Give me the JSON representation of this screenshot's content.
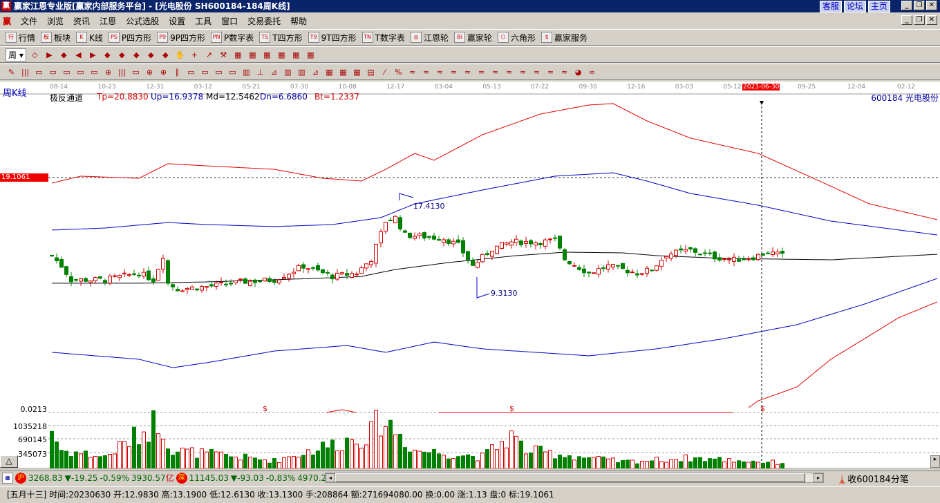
{
  "window": {
    "title": "赢家江恩专业版[赢家内部服务平台] - [光电股份   SH600184-184周K线]",
    "links": [
      "客服",
      "论坛",
      "主页"
    ],
    "app_icon": "赢"
  },
  "menu": {
    "logo": "赢",
    "items": [
      "文件",
      "浏览",
      "资讯",
      "江恩",
      "公式选股",
      "设置",
      "工具",
      "窗口",
      "交易委托",
      "帮助"
    ]
  },
  "toolbar1": [
    {
      "icon": "行",
      "label": "行情"
    },
    {
      "icon": "板",
      "label": "板块"
    },
    {
      "icon": "K",
      "label": "K线"
    },
    {
      "icon": "PS",
      "label": "P四方形"
    },
    {
      "icon": "P9",
      "label": "9P四方形"
    },
    {
      "icon": "PN",
      "label": "P数字表"
    },
    {
      "icon": "TS",
      "label": "T四方形"
    },
    {
      "icon": "T9",
      "label": "9T四方形"
    },
    {
      "icon": "TN",
      "label": "T数字表"
    },
    {
      "icon": "◎",
      "label": "江恩轮"
    },
    {
      "icon": "Bi",
      "label": "赢家轮"
    },
    {
      "icon": "⬡",
      "label": "六角形"
    },
    {
      "icon": "$",
      "label": "赢家服务"
    }
  ],
  "toolbar2": {
    "period_button": "周",
    "icons": [
      "◇",
      "▶",
      "◆",
      "◀",
      "▶",
      "◆",
      "◆",
      "◆",
      "◆",
      "◆",
      "✋",
      "+",
      "↗",
      "⚒",
      "▦",
      "▦",
      "▦",
      "▦",
      "▦",
      "▦"
    ]
  },
  "toolbar3": {
    "icons": [
      "✎",
      "|||",
      "▭",
      "▭",
      "▭",
      "▭",
      "▭",
      "⊕",
      "|||",
      "▭",
      "⊕",
      "⊕",
      "∥",
      "▭",
      "▭",
      "▭",
      "▭",
      "▥",
      "⊥",
      "⊿",
      "▥",
      "▥",
      "⊿",
      "▦",
      "▦",
      "▦",
      "▤",
      "⁄",
      "%",
      "≈",
      "≈",
      "≈",
      "≈",
      "≈",
      "≈",
      "≈",
      "≈",
      "≈",
      "≈",
      "≈",
      "≈",
      "◕",
      "∞"
    ]
  },
  "chart": {
    "period_label": "周K线",
    "stock_label": "600184  光电股份",
    "indicator_name": "极反通道",
    "indicators": [
      {
        "text": "Tp=20.8830",
        "color": "#d00000"
      },
      {
        "text": "Up=16.9378",
        "color": "#0000a0"
      },
      {
        "text": "Md=12.5462",
        "color": "#000000"
      },
      {
        "text": "Dn=6.6860",
        "color": "#0000a0"
      },
      {
        "text": "Bt=1.2337",
        "color": "#d00000"
      }
    ],
    "dates": [
      "08-14",
      "10-23",
      "12-31",
      "03-12",
      "05-21",
      "07-30",
      "10-08",
      "12-17",
      "03-04",
      "05-13",
      "07-22",
      "09-30",
      "12-16",
      "03-03",
      "05-12",
      "2023-06-30",
      "09-25",
      "12-04",
      "02-12"
    ],
    "highlight_date": "2023-06-30",
    "cursor_price": "19.1061",
    "high_label": "17.4130",
    "low_label": "9.3130",
    "sub_axis": {
      "indicator_value": "0.0213",
      "volume_ticks": [
        "1035218",
        "690145",
        "345073"
      ],
      "marker": "$"
    },
    "colors": {
      "up": "#d00000",
      "down": "#008000",
      "upper_red": "#e00000",
      "band_blue": "#0000c0",
      "mid": "#000000"
    }
  },
  "chart_data": {
    "type": "candlestick",
    "price_keypoints_week_close": [
      [
        0,
        12.79
      ],
      [
        2,
        11.92
      ],
      [
        4,
        10.77
      ],
      [
        11,
        10.77
      ],
      [
        18,
        11.34
      ],
      [
        21,
        10.77
      ],
      [
        23,
        12.79
      ],
      [
        24,
        10.48
      ],
      [
        26,
        10.01
      ],
      [
        32,
        10.19
      ],
      [
        39,
        10.59
      ],
      [
        46,
        10.77
      ],
      [
        52,
        11.92
      ],
      [
        58,
        11.05
      ],
      [
        63,
        11.34
      ],
      [
        66,
        12.5
      ],
      [
        69,
        15.68
      ],
      [
        71,
        15.97
      ],
      [
        73,
        14.52
      ],
      [
        81,
        14.23
      ],
      [
        84,
        13.66
      ],
      [
        87,
        11.92
      ],
      [
        91,
        13.37
      ],
      [
        95,
        13.94
      ],
      [
        101,
        13.94
      ],
      [
        104,
        14.06
      ],
      [
        106,
        12.5
      ],
      [
        111,
        11.34
      ],
      [
        115,
        11.92
      ],
      [
        121,
        11.34
      ],
      [
        124,
        11.63
      ],
      [
        127,
        12.9
      ],
      [
        132,
        13.25
      ],
      [
        137,
        12.67
      ],
      [
        141,
        12.44
      ],
      [
        145,
        12.67
      ],
      [
        148,
        13.08
      ],
      [
        151,
        12.79
      ]
    ],
    "tp_line": [
      [
        0,
        18.86
      ],
      [
        6,
        19.44
      ],
      [
        18,
        19.26
      ],
      [
        24,
        20.48
      ],
      [
        32,
        20.3
      ],
      [
        46,
        20.01
      ],
      [
        56,
        19.26
      ],
      [
        64,
        19.03
      ],
      [
        69,
        20.01
      ],
      [
        75,
        21.34
      ],
      [
        79,
        20.77
      ],
      [
        89,
        22.9
      ],
      [
        101,
        24.64
      ],
      [
        111,
        25.39
      ],
      [
        116,
        25.51
      ],
      [
        123,
        24.06
      ],
      [
        132,
        22.62
      ],
      [
        146,
        21.34
      ],
      [
        158,
        19.15
      ],
      [
        169,
        17.12
      ],
      [
        183,
        15.8
      ]
    ],
    "up_line": [
      [
        0,
        14.93
      ],
      [
        11,
        15.1
      ],
      [
        24,
        15.56
      ],
      [
        32,
        15.39
      ],
      [
        46,
        15.22
      ],
      [
        58,
        15.39
      ],
      [
        68,
        15.97
      ],
      [
        75,
        17.12
      ],
      [
        89,
        18.28
      ],
      [
        104,
        19.44
      ],
      [
        116,
        19.72
      ],
      [
        123,
        19.03
      ],
      [
        132,
        17.99
      ],
      [
        146,
        17.01
      ],
      [
        161,
        15.68
      ],
      [
        183,
        14.52
      ]
    ],
    "md_line": [
      [
        0,
        10.48
      ],
      [
        18,
        10.48
      ],
      [
        32,
        10.59
      ],
      [
        54,
        10.88
      ],
      [
        64,
        11.05
      ],
      [
        71,
        11.63
      ],
      [
        82,
        12.21
      ],
      [
        96,
        12.79
      ],
      [
        106,
        13.08
      ],
      [
        118,
        13.02
      ],
      [
        125,
        12.79
      ],
      [
        139,
        12.56
      ],
      [
        161,
        12.44
      ],
      [
        183,
        12.9
      ]
    ],
    "dn_line": [
      [
        0,
        4.7
      ],
      [
        18,
        4.12
      ],
      [
        25,
        3.42
      ],
      [
        32,
        3.83
      ],
      [
        46,
        4.81
      ],
      [
        61,
        5.27
      ],
      [
        69,
        4.7
      ],
      [
        79,
        5.56
      ],
      [
        89,
        4.99
      ],
      [
        111,
        4.41
      ],
      [
        125,
        4.99
      ],
      [
        139,
        5.85
      ],
      [
        154,
        7.01
      ],
      [
        168,
        8.74
      ],
      [
        183,
        10.88
      ]
    ],
    "bt_line": [
      [
        144,
        0.07
      ],
      [
        146,
        0.65
      ],
      [
        154,
        1.8
      ],
      [
        161,
        4.12
      ],
      [
        168,
        5.85
      ],
      [
        175,
        7.59
      ],
      [
        183,
        8.92
      ]
    ],
    "volume_keypoints": [
      [
        0,
        1000000
      ],
      [
        2,
        470000
      ],
      [
        11,
        300000
      ],
      [
        20,
        1050000
      ],
      [
        22,
        1300000
      ],
      [
        25,
        470000
      ],
      [
        46,
        200000
      ],
      [
        66,
        900000
      ],
      [
        68,
        1300000
      ],
      [
        71,
        1000000
      ],
      [
        75,
        470000
      ],
      [
        89,
        300000
      ],
      [
        95,
        850000
      ],
      [
        98,
        470000
      ],
      [
        118,
        170000
      ],
      [
        132,
        270000
      ],
      [
        152,
        140000
      ]
    ],
    "y_price_labels": [
      "19.1061",
      "17.4130",
      "9.3130"
    ]
  },
  "status": {
    "sh_badge": "沪",
    "sh_index": "3268.83",
    "sh_change": "▼-19.25",
    "sh_pct": "-0.59%",
    "sh_amount": "3930.57",
    "unit": "亿",
    "sz_badge": "深",
    "sz_index": "11145.03",
    "sz_change": "▼-93.03",
    "sz_pct": "-0.83%",
    "sz_amount": "4970.2",
    "recv": "收600184分笔"
  },
  "bar_info": "[五月十三] 时间:20230630 开:12.9830 高:13.1900 低:12.6130 收:13.1300 手:208864 额:271694080.00 换:0.00 涨:1.13 盘:0 标:19.1061"
}
